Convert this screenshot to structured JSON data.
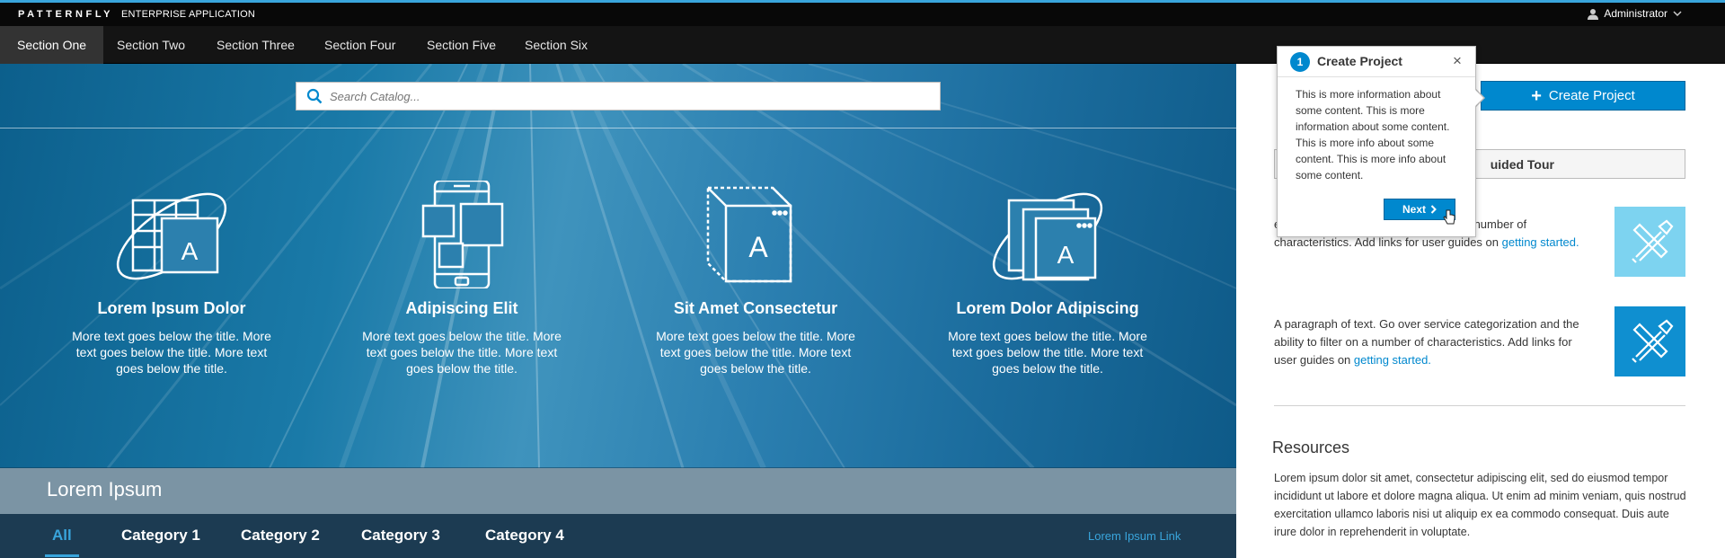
{
  "masthead": {
    "brand": "PATTERNFLY",
    "subtitle": "ENTERPRISE APPLICATION",
    "user": "Administrator",
    "user_icon": "user-icon",
    "caret_icon": "chevron-down-icon"
  },
  "nav": {
    "items": [
      "Section One",
      "Section Two",
      "Section Three",
      "Section Four",
      "Section Five",
      "Section Six"
    ],
    "active": "Section One"
  },
  "search": {
    "placeholder": "Search Catalog...",
    "icon": "search-icon"
  },
  "features": [
    {
      "title": "Lorem Ipsum Dolor",
      "desc": "More text goes below the title. More text goes below the title. More text goes below the title.",
      "icon": "grid-template-icon"
    },
    {
      "title": "Adipiscing Elit",
      "desc": "More text goes below the title. More text goes below the title. More text goes below the title.",
      "icon": "mobile-devices-icon"
    },
    {
      "title": "Sit Amet Consectetur",
      "desc": "More text goes below the title. More text goes below the title. More text goes below the title.",
      "icon": "cube-icon"
    },
    {
      "title": "Lorem Dolor Adipiscing",
      "desc": "More text goes below the title. More text goes below the title. More text goes below the title.",
      "icon": "stacked-windows-icon"
    }
  ],
  "band": {
    "title": "Lorem Ipsum"
  },
  "categories": {
    "tabs": [
      "All",
      "Category 1",
      "Category 2",
      "Category 3",
      "Category 4"
    ],
    "active": "All",
    "link": "Lorem Ipsum Link"
  },
  "sidebar": {
    "create_button": "Create Project",
    "tour_button": "uided Tour",
    "paragraph1": {
      "text": "egorization and the ability to filter on a number of characteristics. Add links for user guides on ",
      "link": "getting started."
    },
    "paragraph2": {
      "text": "A paragraph of text. Go over service categorization and the ability to filter on a number of characteristics. Add links for user guides on ",
      "link": "getting started."
    },
    "tile_icon": "tools-icon",
    "resources_title": "Resources",
    "resources_text": "Lorem ipsum dolor sit amet, consectetur adipiscing elit, sed do eiusmod tempor incididunt ut labore et dolore magna aliqua. Ut enim ad minim veniam, quis nostrud exercitation ullamco laboris nisi ut aliquip ex ea commodo consequat. Duis aute irure dolor in reprehenderit in voluptate."
  },
  "popover": {
    "step": "1",
    "title": "Create Project",
    "close": "×",
    "body": "This is more information about some content. This is more information about some content. This is more info about some content. This is more info about some content.",
    "next": "Next"
  },
  "colors": {
    "accent": "#39a5dc",
    "primary": "#0088ce",
    "masthead": "#080808",
    "nav": "#141414"
  }
}
